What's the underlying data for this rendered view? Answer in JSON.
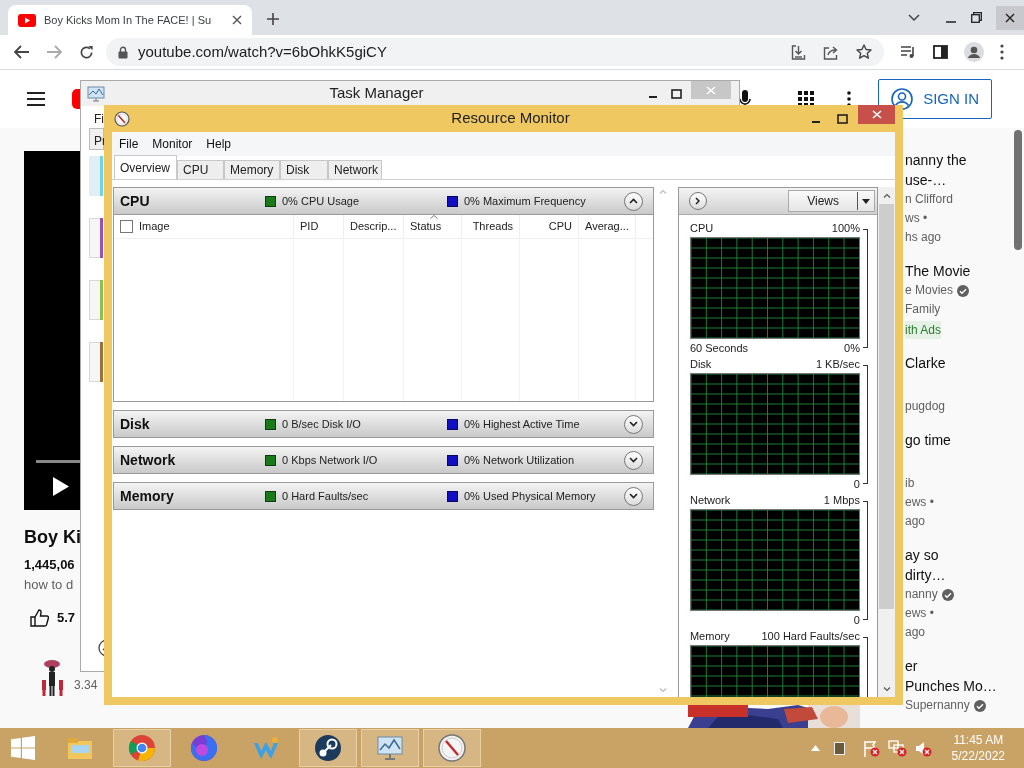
{
  "browser": {
    "tab_title": "Boy Kicks Mom In The FACE! | Su",
    "url": "youtube.com/watch?v=6bOhkK5giCY"
  },
  "youtube": {
    "sign_in": "SIGN IN",
    "video_title": "Boy Ki",
    "views": "1,445,06",
    "description": "how to d",
    "likes": "5.7",
    "subscribers": "3.34",
    "recommendations": [
      {
        "lines": [
          {
            "kind": "title",
            "text": "nanny the"
          },
          {
            "kind": "title",
            "text": "use-…"
          },
          {
            "kind": "meta",
            "text": "n Clifford"
          },
          {
            "kind": "meta",
            "text": "ws •"
          },
          {
            "kind": "meta",
            "text": "hs ago"
          }
        ]
      },
      {
        "lines": [
          {
            "kind": "title",
            "text": "The Movie"
          },
          {
            "kind": "verified",
            "text": "e Movies"
          },
          {
            "kind": "meta",
            "text": "Family"
          },
          {
            "kind": "badge",
            "text": "ith Ads"
          }
        ]
      },
      {
        "lines": [
          {
            "kind": "title",
            "text": "Clarke"
          },
          {
            "kind": "gap"
          },
          {
            "kind": "meta",
            "text": "pugdog"
          }
        ]
      },
      {
        "lines": [
          {
            "kind": "title",
            "text": "go time"
          },
          {
            "kind": "gap"
          },
          {
            "kind": "meta",
            "text": "ib"
          },
          {
            "kind": "meta",
            "text": "ews •"
          },
          {
            "kind": "meta",
            "text": "ago"
          }
        ]
      },
      {
        "lines": [
          {
            "kind": "title",
            "text": "ay so"
          },
          {
            "kind": "title",
            "text": "dirty…"
          },
          {
            "kind": "verified",
            "text": "nanny"
          },
          {
            "kind": "meta",
            "text": "ews •"
          },
          {
            "kind": "meta",
            "text": "ago"
          }
        ]
      },
      {
        "lines": [
          {
            "kind": "title",
            "text": "er"
          },
          {
            "kind": "title",
            "text": "Punches Mo…"
          },
          {
            "kind": "verified",
            "text": "Supernanny"
          }
        ]
      }
    ]
  },
  "task_manager": {
    "title": "Task Manager",
    "menu": "Fi",
    "tab": "Pr",
    "tiles": [
      {
        "color": "#6cd4e4",
        "selected": true
      },
      {
        "color": "#9b4fb0",
        "selected": false
      },
      {
        "color": "#8cc152",
        "selected": false
      },
      {
        "color": "#a0703a",
        "selected": false
      }
    ]
  },
  "resource_monitor": {
    "title": "Resource Monitor",
    "menu": [
      "File",
      "Monitor",
      "Help"
    ],
    "tabs": [
      {
        "label": "Overview",
        "selected": true
      },
      {
        "label": "CPU",
        "selected": false
      },
      {
        "label": "Memory",
        "selected": false
      },
      {
        "label": "Disk",
        "selected": false
      },
      {
        "label": "Network",
        "selected": false
      }
    ],
    "sections": [
      {
        "name": "CPU",
        "stat_1": "0% CPU Usage",
        "stat_2": "0% Maximum Frequency",
        "expanded": true
      },
      {
        "name": "Disk",
        "stat_1": "0 B/sec Disk I/O",
        "stat_2": "0% Highest Active Time",
        "expanded": false
      },
      {
        "name": "Network",
        "stat_1": "0 Kbps Network I/O",
        "stat_2": "0% Network Utilization",
        "expanded": false
      },
      {
        "name": "Memory",
        "stat_1": "0 Hard Faults/sec",
        "stat_2": "0% Used Physical Memory",
        "expanded": false
      }
    ],
    "columns": [
      {
        "label": "Image",
        "sorted": false
      },
      {
        "label": "PID",
        "sorted": false
      },
      {
        "label": "Descrip...",
        "sorted": false
      },
      {
        "label": "Status",
        "sorted": true
      },
      {
        "label": "Threads",
        "sorted": false
      },
      {
        "label": "CPU",
        "sorted": false
      },
      {
        "label": "Averag...",
        "sorted": false
      }
    ],
    "views_button": "Views",
    "graphs": [
      {
        "label": "CPU",
        "max": "100%",
        "time": "60 Seconds",
        "min": "0%"
      },
      {
        "label": "Disk",
        "max": "1 KB/sec",
        "min": "0"
      },
      {
        "label": "Network",
        "max": "1 Mbps",
        "min": "0"
      },
      {
        "label": "Memory",
        "max": "100 Hard Faults/sec"
      }
    ]
  },
  "taskbar": {
    "apps": [
      {
        "kind": "explorer",
        "running": false
      },
      {
        "kind": "chrome",
        "running": true
      },
      {
        "kind": "firefox",
        "running": false
      },
      {
        "kind": "app",
        "running": false
      },
      {
        "kind": "steam",
        "running": true
      },
      {
        "kind": "monitor",
        "running": true
      },
      {
        "kind": "gauge",
        "running": true
      }
    ],
    "time": "11:45 AM",
    "date": "5/22/2022"
  }
}
